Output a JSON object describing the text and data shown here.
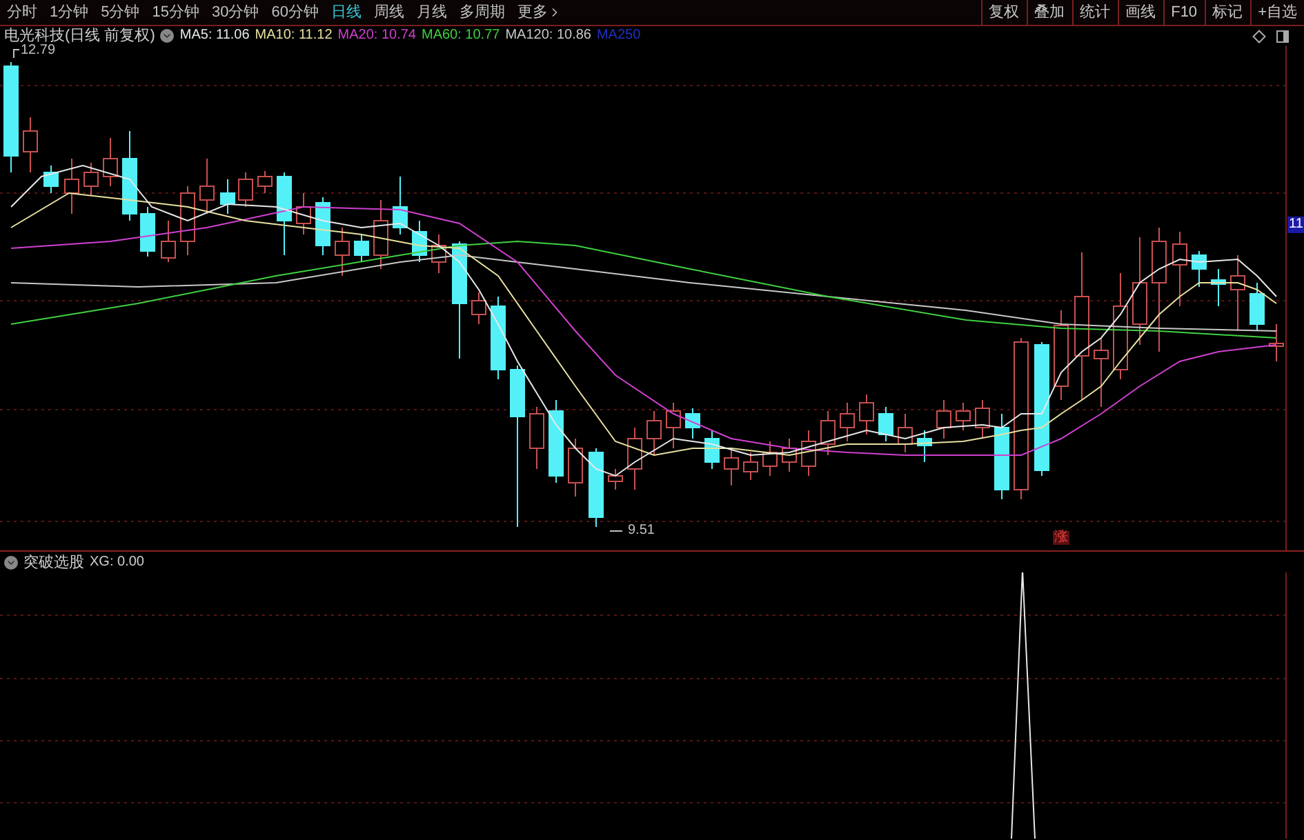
{
  "toolbar": {
    "tabs": [
      {
        "label": "分时",
        "selected": false
      },
      {
        "label": "1分钟",
        "selected": false
      },
      {
        "label": "5分钟",
        "selected": false
      },
      {
        "label": "15分钟",
        "selected": false
      },
      {
        "label": "30分钟",
        "selected": false
      },
      {
        "label": "60分钟",
        "selected": false
      },
      {
        "label": "日线",
        "selected": true
      },
      {
        "label": "周线",
        "selected": false
      },
      {
        "label": "月线",
        "selected": false
      },
      {
        "label": "多周期",
        "selected": false
      },
      {
        "label": "更多",
        "selected": false
      }
    ],
    "buttons": [
      "复权",
      "叠加",
      "统计",
      "画线",
      "F10",
      "标记",
      "+自选"
    ]
  },
  "main_chart": {
    "title": "电光科技(日线 前复权)",
    "indicators": [
      {
        "text": "MA5: 11.06",
        "color": "#e8e8e8"
      },
      {
        "text": "MA10: 11.12",
        "color": "#e8e0a0"
      },
      {
        "text": "MA20: 10.74",
        "color": "#d040d0"
      },
      {
        "text": "MA60: 10.77",
        "color": "#40d040"
      },
      {
        "text": "MA120: 10.86",
        "color": "#c8c8c8"
      },
      {
        "text": "MA250",
        "color": "#2030c0"
      }
    ],
    "high_label": "12.79",
    "low_label": "9.51",
    "price_tag": "11",
    "marker": "涨"
  },
  "sub_chart": {
    "title": "突破选股",
    "value": "XG: 0.00"
  }
}
